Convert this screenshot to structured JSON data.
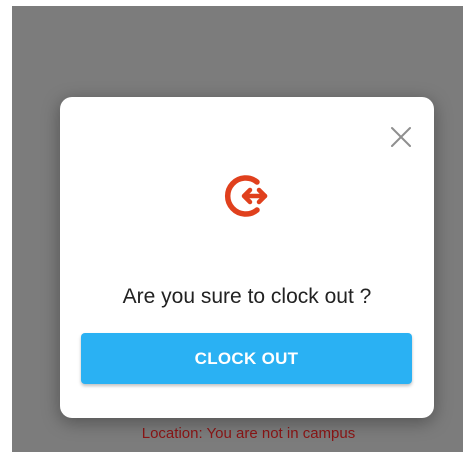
{
  "dialog": {
    "close_icon": "close-icon",
    "icon": "clock-out-icon",
    "confirm_text": "Are you sure to clock out ?",
    "clock_out_label": "CLOCK OUT"
  },
  "status": {
    "location_text": "Location: You are not in campus"
  },
  "colors": {
    "accent_icon": "#e0401d",
    "button": "#2ab1f3",
    "status_text": "#8b1515",
    "backdrop": "#7c7c7c"
  }
}
